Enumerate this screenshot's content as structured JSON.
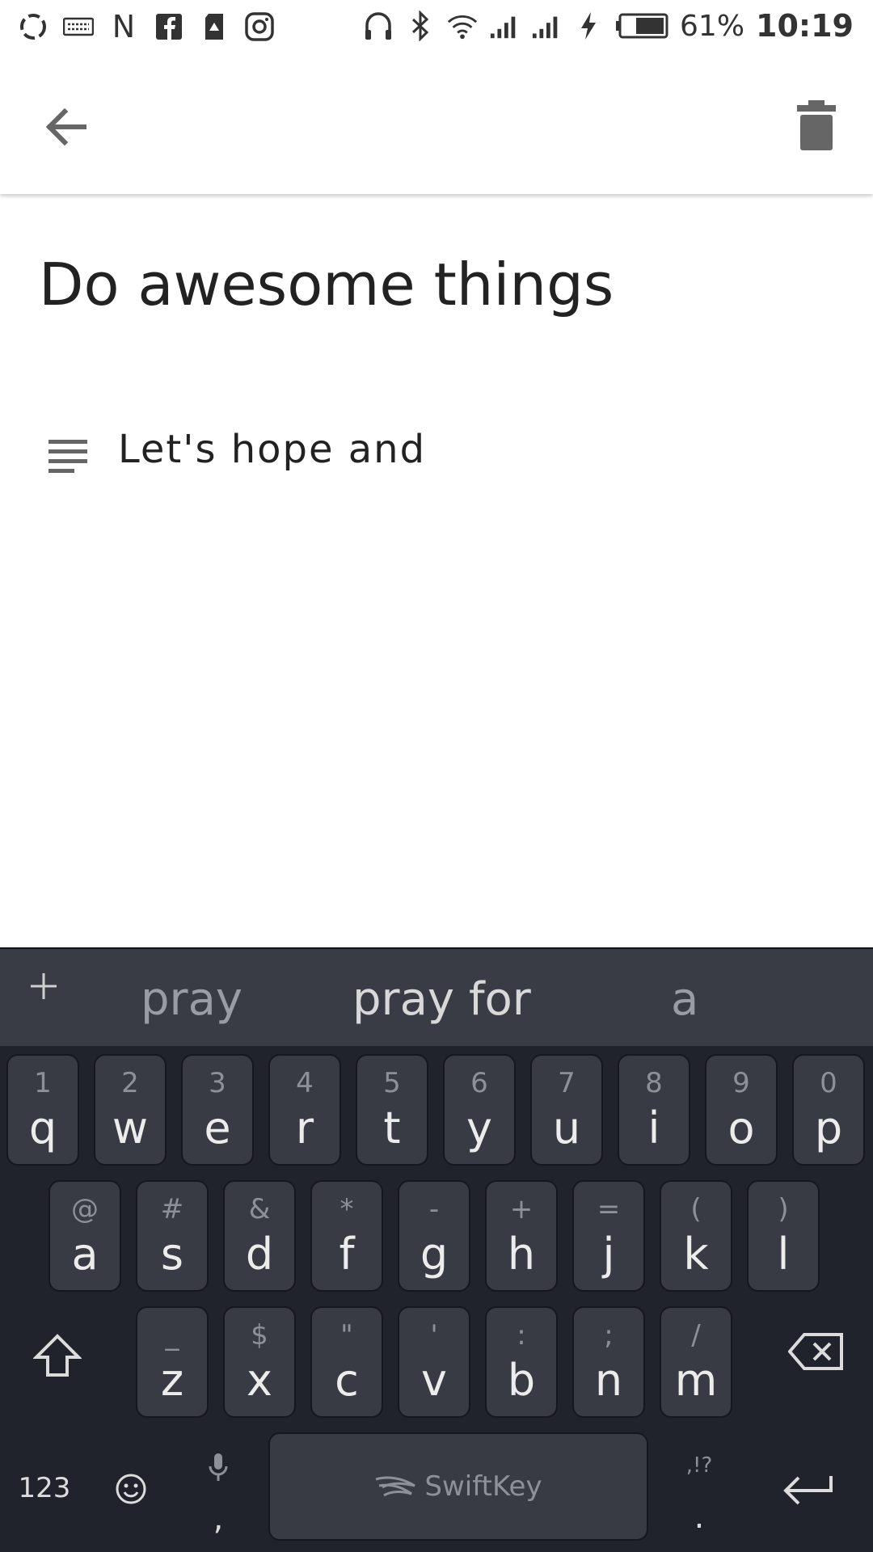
{
  "status_bar": {
    "battery_percent": "61%",
    "time": "10:19",
    "left_icons": [
      "sync-icon",
      "keyboard-icon",
      "n-icon",
      "facebook-icon",
      "sd-icon",
      "instagram-icon"
    ],
    "right_icons": [
      "headphones-icon",
      "bluetooth-icon",
      "wifi-icon",
      "signal-1-icon",
      "signal-2-icon",
      "charging-icon",
      "battery-icon"
    ]
  },
  "app_bar": {
    "back_icon": "arrow-left-icon",
    "delete_icon": "trash-icon"
  },
  "note": {
    "title": "Do awesome things",
    "body": "Let's hope and",
    "body_icon": "text-lines-icon"
  },
  "keyboard": {
    "suggestions": [
      "pray",
      "pray for",
      "a"
    ],
    "row1": [
      {
        "hint": "1",
        "key": "q"
      },
      {
        "hint": "2",
        "key": "w"
      },
      {
        "hint": "3",
        "key": "e"
      },
      {
        "hint": "4",
        "key": "r"
      },
      {
        "hint": "5",
        "key": "t"
      },
      {
        "hint": "6",
        "key": "y"
      },
      {
        "hint": "7",
        "key": "u"
      },
      {
        "hint": "8",
        "key": "i"
      },
      {
        "hint": "9",
        "key": "o"
      },
      {
        "hint": "0",
        "key": "p"
      }
    ],
    "row2": [
      {
        "hint": "@",
        "key": "a"
      },
      {
        "hint": "#",
        "key": "s"
      },
      {
        "hint": "&",
        "key": "d"
      },
      {
        "hint": "*",
        "key": "f"
      },
      {
        "hint": "-",
        "key": "g"
      },
      {
        "hint": "+",
        "key": "h"
      },
      {
        "hint": "=",
        "key": "j"
      },
      {
        "hint": "(",
        "key": "k"
      },
      {
        "hint": ")",
        "key": "l"
      }
    ],
    "row3": [
      {
        "hint": "_",
        "key": "z"
      },
      {
        "hint": "$",
        "key": "x"
      },
      {
        "hint": "\"",
        "key": "c"
      },
      {
        "hint": "'",
        "key": "v"
      },
      {
        "hint": ":",
        "key": "b"
      },
      {
        "hint": ";",
        "key": "n"
      },
      {
        "hint": "/",
        "key": "m"
      }
    ],
    "numbers_label": "123",
    "comma_label": ",",
    "period_label": ".",
    "punct_hint": ",!?",
    "space_brand": "SwiftKey"
  }
}
